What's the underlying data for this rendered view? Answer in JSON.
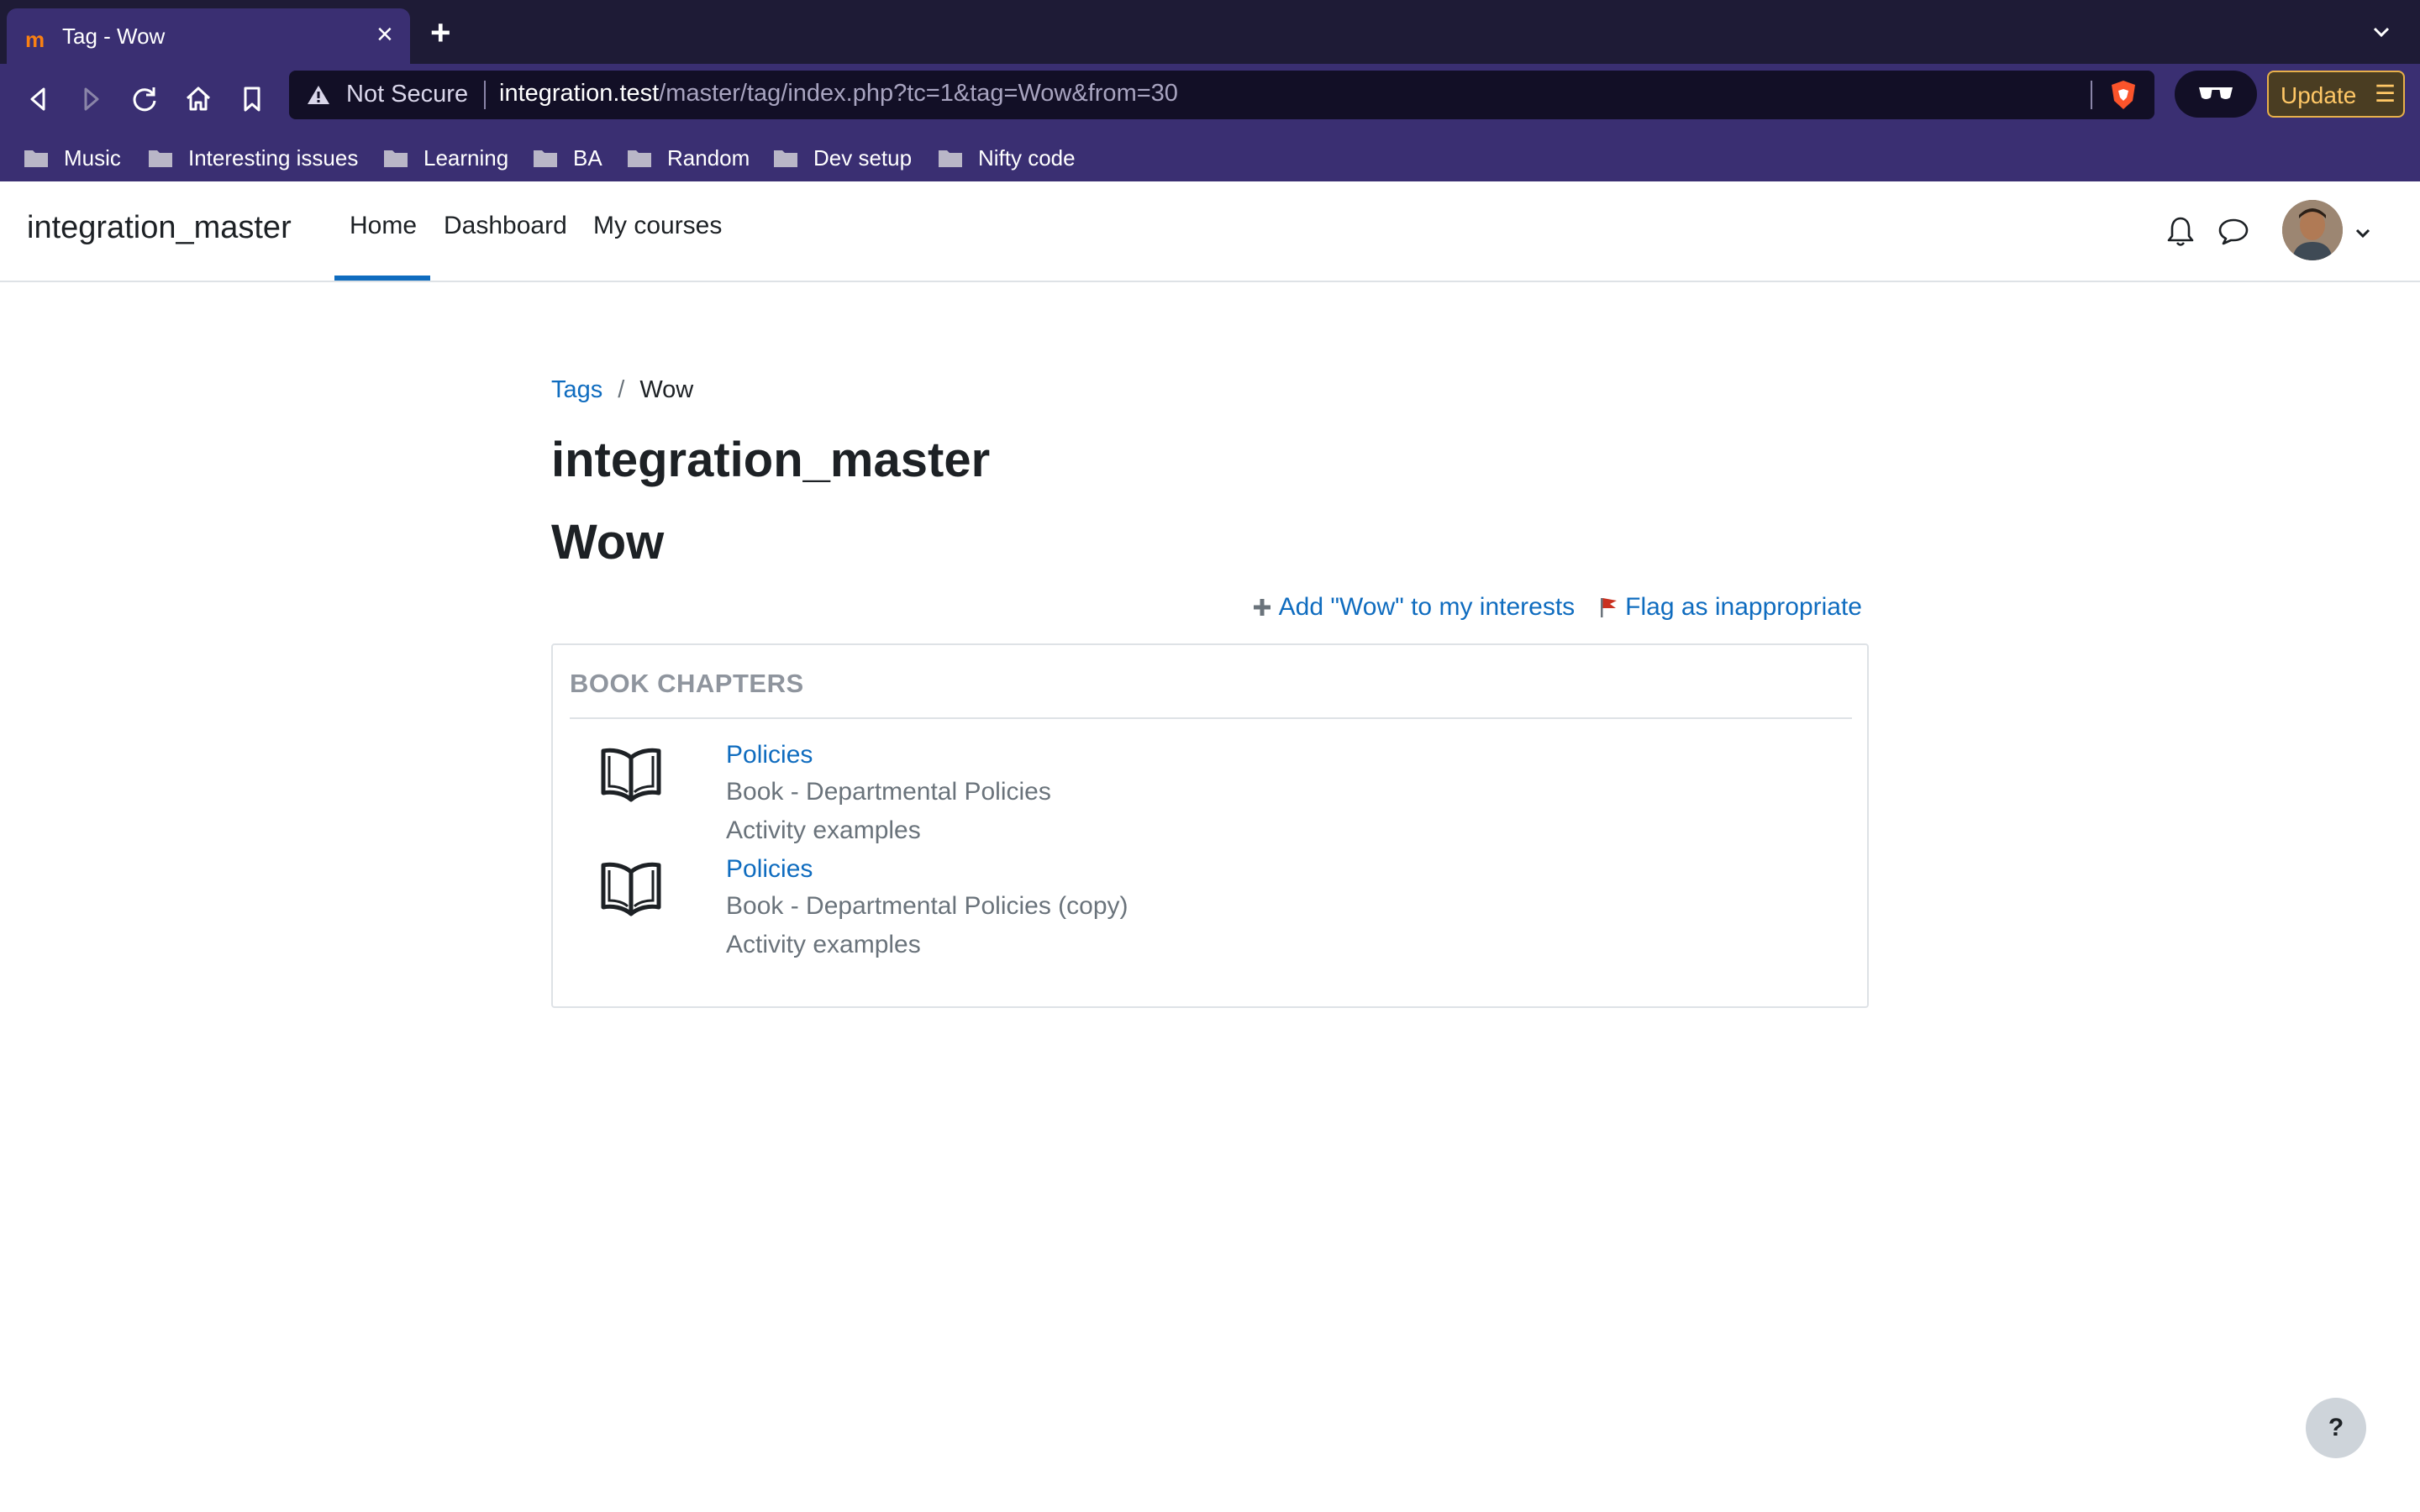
{
  "browser": {
    "tab_title": "Tag - Wow",
    "favicon_text": "m",
    "security_label": "Not Secure",
    "url_host": "integration.test",
    "url_path": "/master/tag/index.php?tc=1&tag=Wow&from=30",
    "update_label": "Update",
    "bookmarks": [
      "Music",
      "Interesting issues",
      "Learning",
      "BA",
      "Random",
      "Dev setup",
      "Nifty code"
    ]
  },
  "navbar": {
    "brand": "integration_master",
    "items": [
      "Home",
      "Dashboard",
      "My courses"
    ],
    "active_item": "Home"
  },
  "breadcrumb": {
    "link": "Tags",
    "separator": "/",
    "current": "Wow"
  },
  "page": {
    "site_title": "integration_master",
    "tag_title": "Wow",
    "add_interest": "Add \"Wow\" to my interests",
    "flag": "Flag as inappropriate"
  },
  "section": {
    "title": "BOOK CHAPTERS",
    "items": [
      {
        "title": "Policies",
        "book": "Book - Departmental Policies",
        "course": "Activity examples"
      },
      {
        "title": "Policies",
        "book": "Book - Departmental Policies (copy)",
        "course": "Activity examples"
      }
    ]
  },
  "help": {
    "label": "?"
  },
  "colors": {
    "link": "#0f6cbf",
    "browser_frame": "#3a2f72",
    "update_accent": "#ffc766"
  }
}
